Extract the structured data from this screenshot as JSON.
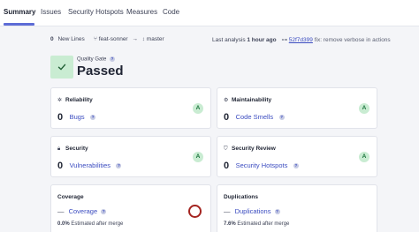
{
  "tabs": [
    {
      "label": "Summary",
      "active": true
    },
    {
      "label": "Issues",
      "active": false
    },
    {
      "label": "Security Hotspots",
      "active": false
    },
    {
      "label": "Measures",
      "active": false
    },
    {
      "label": "Code",
      "active": false
    }
  ],
  "info": {
    "new_lines_count": "0",
    "new_lines_label": "New Lines",
    "branch": "feat-sonner",
    "arrow": "→",
    "target_branch": "master",
    "last_analysis_label": "Last analysis",
    "last_analysis_time": "1 hour ago",
    "commit_hash": "52f7d399",
    "commit_message": "fix: remove verbose in actions"
  },
  "quality_gate": {
    "label": "Quality Gate",
    "status": "Passed",
    "help": "?"
  },
  "cards": {
    "reliability": {
      "title": "Reliability",
      "count": "0",
      "metric": "Bugs",
      "grade": "A"
    },
    "maintainability": {
      "title": "Maintainability",
      "count": "0",
      "metric": "Code Smells",
      "grade": "A"
    },
    "security": {
      "title": "Security",
      "count": "0",
      "metric": "Vulnerabilities",
      "grade": "A"
    },
    "security_review": {
      "title": "Security Review",
      "count": "0",
      "metric": "Security Hotspots",
      "grade": "A"
    },
    "coverage": {
      "title": "Coverage",
      "dash": "—",
      "metric": "Coverage",
      "sub_value": "0.0%",
      "sub_label": "Estimated after merge"
    },
    "duplications": {
      "title": "Duplications",
      "dash": "—",
      "metric": "Duplications",
      "sub_value": "7.6%",
      "sub_label": "Estimated after merge"
    }
  },
  "help_mark": "?",
  "colors": {
    "accent": "#5d6cd6",
    "link": "#3b4cc0",
    "pass_green": "#c9ecd2",
    "grade_text": "#18713a",
    "ring": "#a42420"
  },
  "icons": {
    "reliability": "bug-icon",
    "maintainability": "gear-icon",
    "security": "lock-icon",
    "security_review": "shield-icon",
    "branch": "branch-icon",
    "target": "target-branch-icon",
    "commit": "commit-icon",
    "quality_gate": "check-icon"
  }
}
